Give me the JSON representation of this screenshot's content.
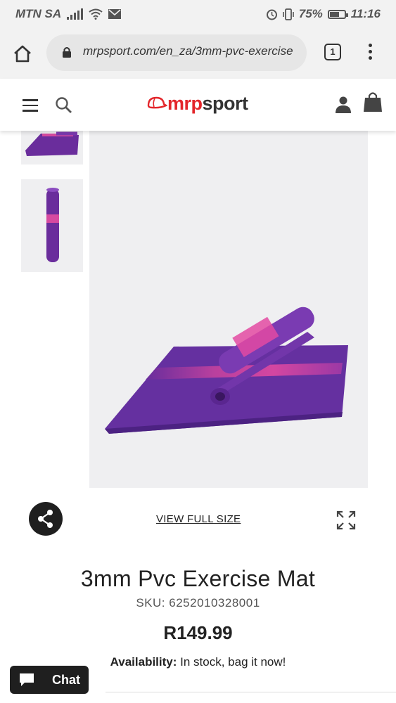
{
  "status_bar": {
    "carrier": "MTN SA",
    "battery_percent": "75%",
    "battery_level": 0.75,
    "time": "11:16"
  },
  "browser": {
    "url": "mrpsport.com/en_za/3mm-pvc-exercise",
    "tab_count": "1"
  },
  "site_header": {
    "logo_mrp": "mrp",
    "logo_sport": "sport",
    "brand_color": "#e3262b"
  },
  "gallery": {
    "view_full_size_label": "VIEW FULL SIZE",
    "mat_colors": {
      "purple": "#6a2d9c",
      "pink": "#e0499b"
    }
  },
  "product": {
    "title": "3mm Pvc Exercise Mat",
    "sku_label": "SKU:",
    "sku_value": "6252010328001",
    "price": "R149.99",
    "availability_label": "Availability:",
    "availability_value": "In stock, bag it now!"
  },
  "chat": {
    "label": "Chat"
  },
  "icons": [
    "wifi-icon",
    "message-icon",
    "alarm-icon",
    "vibrate-icon",
    "home-icon",
    "lock-icon",
    "hamburger-icon",
    "search-icon",
    "account-icon",
    "bag-icon",
    "share-icon",
    "expand-icon",
    "chat-icon"
  ]
}
